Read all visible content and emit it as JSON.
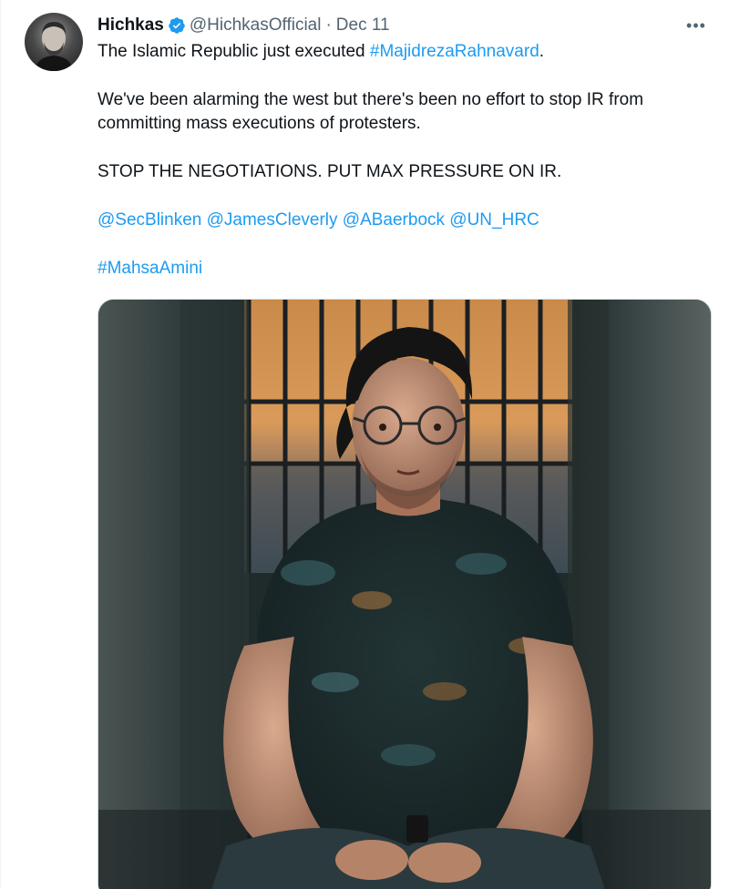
{
  "author": {
    "display_name": "Hichkas",
    "handle": "@HichkasOfficial",
    "separator": "·",
    "date": "Dec 11"
  },
  "menu": {
    "more_glyph": "•••"
  },
  "text": {
    "line1_prefix": "The Islamic Republic just executed ",
    "line1_hashtag": "#MajidrezaRahnavard",
    "line1_suffix": ".",
    "line2": "We've been alarming the west but there's been no effort to stop IR from committing mass executions of protesters.",
    "line3": "STOP THE NEGOTIATIONS. PUT MAX PRESSURE ON IR.",
    "mentions": [
      "@SecBlinken",
      "@JamesCleverly",
      "@ABaerbock",
      "@UN_HRC"
    ],
    "hashtag2": "#MahsaAmini"
  },
  "colors": {
    "link": "#1d9bf0",
    "text": "#0f1419",
    "secondary": "#536471",
    "verified": "#1d9bf0"
  },
  "icons": {
    "verified": "verified-badge-icon",
    "more": "more-options-icon"
  }
}
